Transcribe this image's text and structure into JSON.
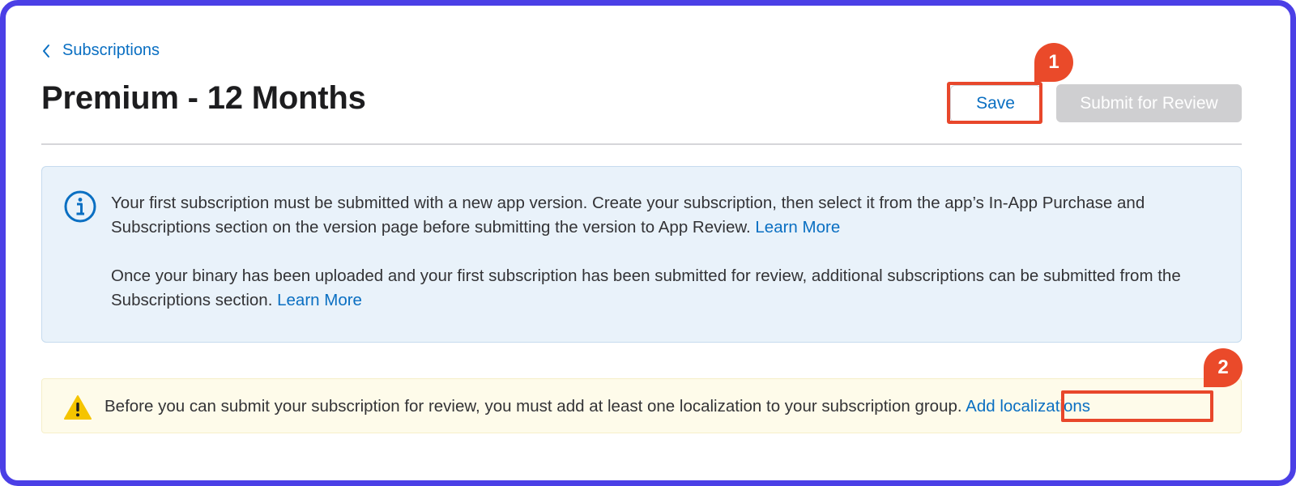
{
  "breadcrumb": {
    "label": "Subscriptions",
    "icon": "chevron-left-icon"
  },
  "page": {
    "title": "Premium - 12 Months"
  },
  "toolbar": {
    "save_label": "Save",
    "submit_label": "Submit for Review",
    "submit_disabled": true
  },
  "annotations": [
    {
      "number": "1",
      "target": "save-button"
    },
    {
      "number": "2",
      "target": "add-localizations-link"
    }
  ],
  "info_notice": {
    "icon": "info-circle-icon",
    "paragraph1_text": "Your first subscription must be submitted with a new app version. Create your subscription, then select it from the app’s In-App Purchase and Subscriptions section on the version page before submitting the version to App Review. ",
    "paragraph1_link": "Learn More",
    "paragraph2_text": "Once your binary has been uploaded and your first subscription has been submitted for review, additional subscriptions can be submitted from the Subscriptions section. ",
    "paragraph2_link": "Learn More"
  },
  "warning_notice": {
    "icon": "warning-triangle-icon",
    "text": "Before you can submit your subscription for review, you must add at least one localization to your subscription group. ",
    "link": "Add localizations"
  },
  "colors": {
    "link": "#0a6fc2",
    "frame": "#4b3fe6",
    "highlight": "#e8472b",
    "marker": "#ea4a2a",
    "info_background": "#e9f2fa",
    "warning_background": "#fefbea",
    "warning_icon": "#f5c400",
    "disabled_button": "#cfcfd1"
  }
}
